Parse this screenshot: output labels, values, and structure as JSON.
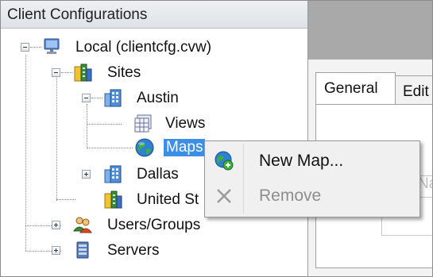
{
  "left_pane": {
    "header": "Client Configurations",
    "tree": {
      "root": "Local (clientcfg.cvw)",
      "sites": "Sites",
      "austin": "Austin",
      "views": "Views",
      "maps": "Maps",
      "dallas": "Dallas",
      "united_states": "United St",
      "users_groups": "Users/Groups",
      "servers": "Servers"
    }
  },
  "right_pane": {
    "tabs": [
      "General",
      "Edit"
    ],
    "faint_label": "Na"
  },
  "context_menu": {
    "items": [
      {
        "label": "New Map...",
        "icon": "globe-add-icon",
        "enabled": true
      },
      {
        "label": "Remove",
        "icon": "x-icon",
        "enabled": false
      }
    ]
  },
  "colors": {
    "selection": "#3d8ee6",
    "menu_background": "#f0f0f0",
    "disabled_text": "#8d8d8d"
  }
}
